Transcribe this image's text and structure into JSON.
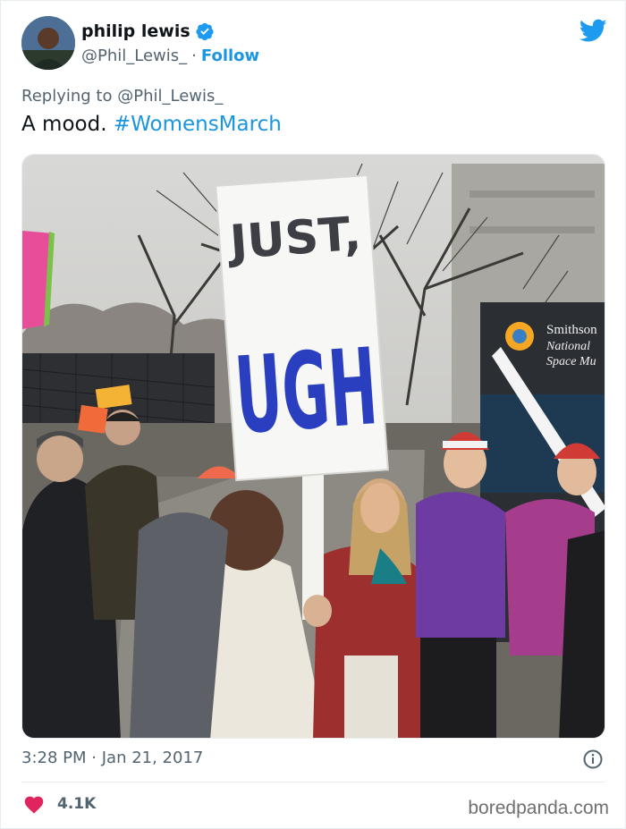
{
  "tweet": {
    "author_name": "philip lewis",
    "author_handle": "@Phil_Lewis_",
    "separator": "·",
    "follow_label": "Follow",
    "replying_prefix": "Replying to",
    "replying_to": "@Phil_Lewis_",
    "text": "A mood.",
    "hashtag": "#WomensMarch",
    "time": "3:28 PM",
    "date": "Jan 21, 2017",
    "likes": "4.1K"
  },
  "photo": {
    "sign_line1": "JUST,",
    "sign_line2": "UGH",
    "museum_line1": "Smithson",
    "museum_line2": "National",
    "museum_line3": "Space Mu"
  },
  "watermark": "boredpanda.com",
  "colors": {
    "link": "#1b95e0",
    "verified": "#1d9bf0",
    "heart": "#e0245e",
    "muted": "#536471"
  },
  "icons": [
    "verified-badge-icon",
    "twitter-bird-icon",
    "info-icon",
    "heart-icon"
  ]
}
